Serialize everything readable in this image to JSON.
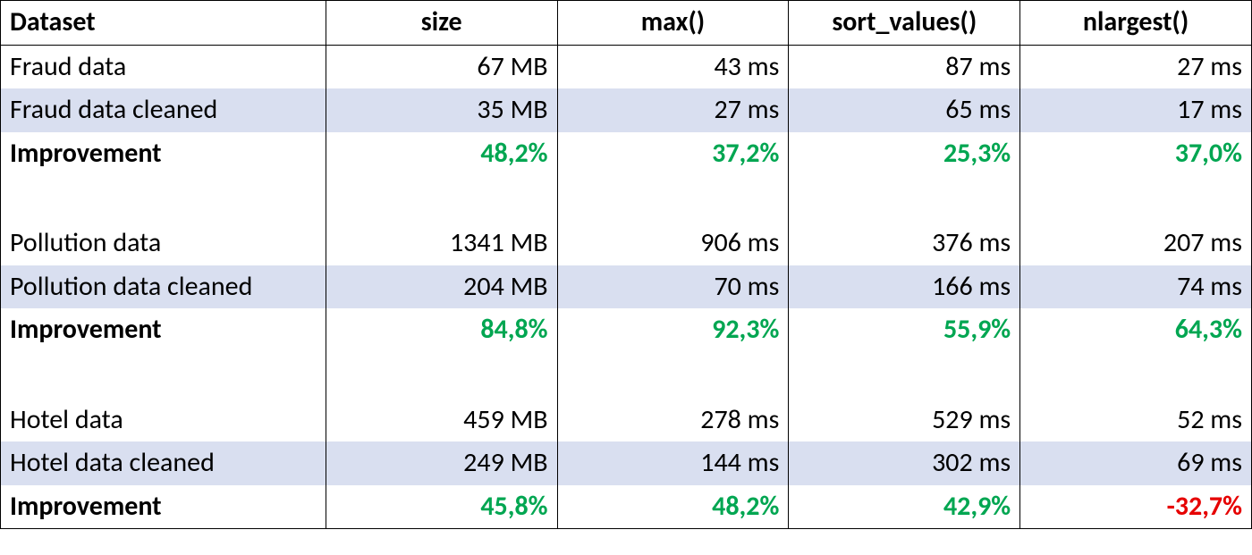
{
  "headers": [
    "Dataset",
    "size",
    "max()",
    "sort_values()",
    "nlargest()"
  ],
  "groups": [
    {
      "raw": {
        "label": "Fraud data",
        "size": "67 MB",
        "max": "43 ms",
        "sort": "87 ms",
        "nlarg": "27 ms"
      },
      "cleaned": {
        "label": "Fraud data cleaned",
        "size": "35 MB",
        "max": "27 ms",
        "sort": "65 ms",
        "nlarg": "17 ms"
      },
      "improve": {
        "label": "Improvement",
        "size": "48,2%",
        "max": "37,2%",
        "sort": "25,3%",
        "nlarg": "37,0%",
        "neg": {
          "size": false,
          "max": false,
          "sort": false,
          "nlarg": false
        }
      }
    },
    {
      "raw": {
        "label": "Pollution data",
        "size": "1341 MB",
        "max": "906 ms",
        "sort": "376 ms",
        "nlarg": "207 ms"
      },
      "cleaned": {
        "label": "Pollution data cleaned",
        "size": "204 MB",
        "max": "70 ms",
        "sort": "166 ms",
        "nlarg": "74 ms"
      },
      "improve": {
        "label": "Improvement",
        "size": "84,8%",
        "max": "92,3%",
        "sort": "55,9%",
        "nlarg": "64,3%",
        "neg": {
          "size": false,
          "max": false,
          "sort": false,
          "nlarg": false
        }
      }
    },
    {
      "raw": {
        "label": "Hotel data",
        "size": "459 MB",
        "max": "278 ms",
        "sort": "529 ms",
        "nlarg": "52 ms"
      },
      "cleaned": {
        "label": "Hotel data cleaned",
        "size": "249 MB",
        "max": "144 ms",
        "sort": "302 ms",
        "nlarg": "69 ms"
      },
      "improve": {
        "label": "Improvement",
        "size": "45,8%",
        "max": "48,2%",
        "sort": "42,9%",
        "nlarg": "-32,7%",
        "neg": {
          "size": false,
          "max": false,
          "sort": false,
          "nlarg": true
        }
      }
    }
  ],
  "chart_data": {
    "type": "table",
    "columns": [
      "Dataset",
      "size",
      "max()",
      "sort_values()",
      "nlargest()"
    ],
    "rows": [
      [
        "Fraud data",
        "67 MB",
        "43 ms",
        "87 ms",
        "27 ms"
      ],
      [
        "Fraud data cleaned",
        "35 MB",
        "27 ms",
        "65 ms",
        "17 ms"
      ],
      [
        "Improvement",
        "48,2%",
        "37,2%",
        "25,3%",
        "37,0%"
      ],
      [
        "Pollution data",
        "1341 MB",
        "906 ms",
        "376 ms",
        "207 ms"
      ],
      [
        "Pollution data cleaned",
        "204 MB",
        "70 ms",
        "166 ms",
        "74 ms"
      ],
      [
        "Improvement",
        "84,8%",
        "92,3%",
        "55,9%",
        "64,3%"
      ],
      [
        "Hotel data",
        "459 MB",
        "278 ms",
        "529 ms",
        "52 ms"
      ],
      [
        "Hotel data cleaned",
        "249 MB",
        "144 ms",
        "302 ms",
        "69 ms"
      ],
      [
        "Improvement",
        "45,8%",
        "48,2%",
        "42,9%",
        "-32,7%"
      ]
    ]
  }
}
